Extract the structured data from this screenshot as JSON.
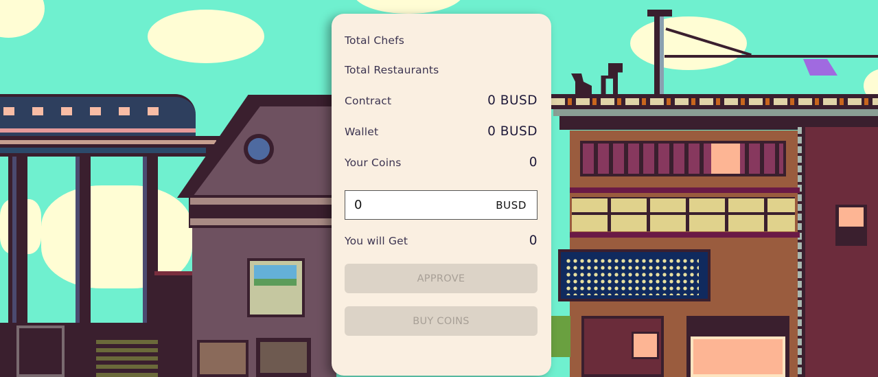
{
  "stats": [
    {
      "label": "Total Chefs",
      "value": ""
    },
    {
      "label": "Total Restaurants",
      "value": ""
    },
    {
      "label": "Contract",
      "value": "0 BUSD"
    },
    {
      "label": "Wallet",
      "value": "0 BUSD"
    },
    {
      "label": "Your Coins",
      "value": "0"
    }
  ],
  "amount_input": {
    "value": "0",
    "unit": "BUSD"
  },
  "you_will_get": {
    "label": "You will Get",
    "value": "0"
  },
  "buttons": {
    "approve": "APPROVE",
    "buy_coins": "BUY COINS"
  },
  "colors": {
    "sky": "#6ff0cf",
    "cloud": "#fffdd4",
    "card": "#faefe1",
    "button_disabled_bg": "#dcd3c7",
    "button_disabled_text": "#a79f96",
    "text": "#2b2340"
  }
}
